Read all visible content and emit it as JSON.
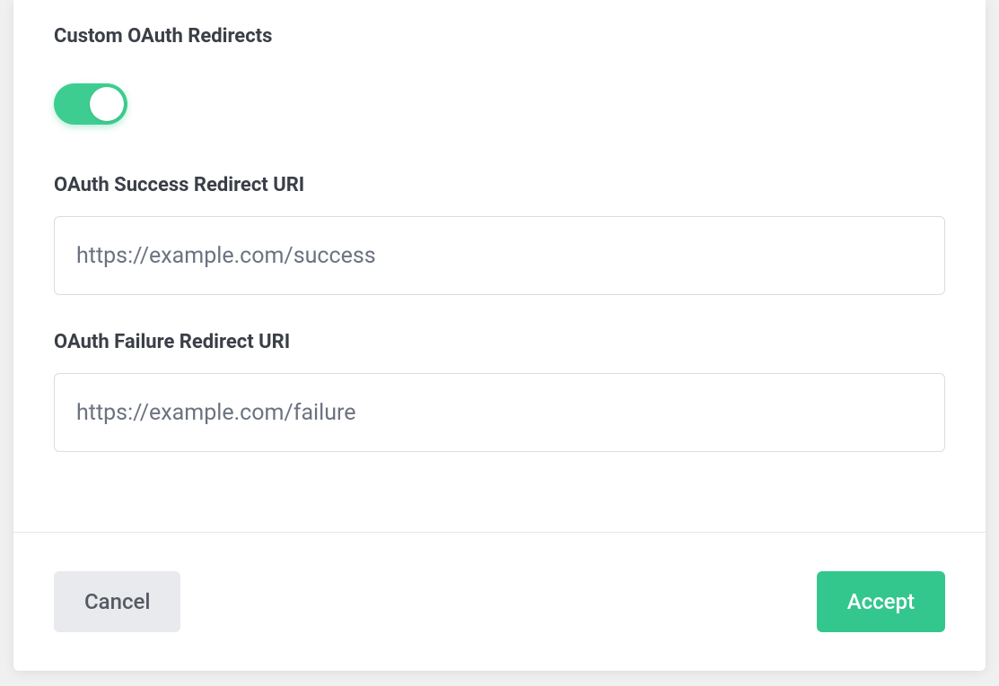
{
  "section": {
    "title": "Custom OAuth Redirects",
    "toggle_enabled": true
  },
  "fields": {
    "success": {
      "label": "OAuth Success Redirect URI",
      "value": "https://example.com/success"
    },
    "failure": {
      "label": "OAuth Failure Redirect URI",
      "value": "https://example.com/failure"
    }
  },
  "footer": {
    "cancel_label": "Cancel",
    "accept_label": "Accept"
  }
}
